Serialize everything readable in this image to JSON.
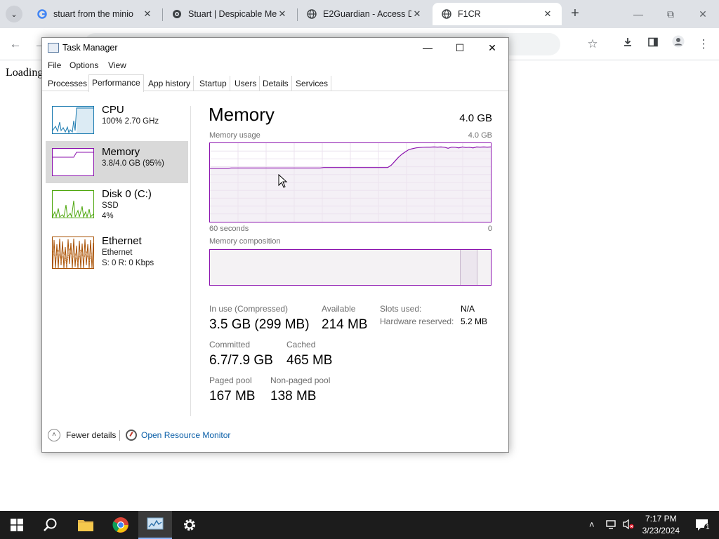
{
  "browser": {
    "tabs": [
      {
        "title": "stuart from the minio",
        "favicon": "google-g-icon",
        "active": false
      },
      {
        "title": "Stuart | Despicable Me",
        "favicon": "site-icon",
        "active": false
      },
      {
        "title": "E2Guardian - Access D",
        "favicon": "globe-icon",
        "active": false
      },
      {
        "title": "F1CR",
        "favicon": "globe-icon",
        "active": true
      }
    ],
    "new_tab": "+",
    "page_text": "Loading"
  },
  "task_manager": {
    "title": "Task Manager",
    "menu": [
      "File",
      "Options",
      "View"
    ],
    "tabs": [
      "Processes",
      "Performance",
      "App history",
      "Startup",
      "Users",
      "Details",
      "Services"
    ],
    "active_tab": "Performance",
    "sidebar": [
      {
        "name": "CPU",
        "line1": "100%  2.70 GHz",
        "line2": "",
        "color": "#1a7ab0"
      },
      {
        "name": "Memory",
        "line1": "3.8/4.0 GB (95%)",
        "line2": "",
        "color": "#8b12ae"
      },
      {
        "name": "Disk 0 (C:)",
        "line1": "SSD",
        "line2": "4%",
        "color": "#4da60c"
      },
      {
        "name": "Ethernet",
        "line1": "Ethernet",
        "line2": "S: 0  R: 0 Kbps",
        "color": "#a74f01"
      }
    ],
    "detail": {
      "title": "Memory",
      "total": "4.0 GB",
      "usage_label": "Memory usage",
      "usage_max": "4.0 GB",
      "time_left": "60 seconds",
      "time_right": "0",
      "composition_label": "Memory composition",
      "stats": {
        "in_use_label": "In use (Compressed)",
        "in_use": "3.5 GB (299 MB)",
        "available_label": "Available",
        "available": "214 MB",
        "committed_label": "Committed",
        "committed": "6.7/7.9 GB",
        "cached_label": "Cached",
        "cached": "465 MB",
        "paged_label": "Paged pool",
        "paged": "167 MB",
        "nonpaged_label": "Non-paged pool",
        "nonpaged": "138 MB"
      },
      "kv": {
        "slots_label": "Slots used:",
        "slots": "N/A",
        "hw_label": "Hardware reserved:",
        "hw": "5.2 MB"
      },
      "usage_series": [
        0.68,
        0.68,
        0.68,
        0.68,
        0.68,
        0.68,
        0.685,
        0.685,
        0.685,
        0.685,
        0.685,
        0.685,
        0.685,
        0.685,
        0.685,
        0.685,
        0.685,
        0.685,
        0.685,
        0.685,
        0.685,
        0.685,
        0.685,
        0.685,
        0.685,
        0.685,
        0.685,
        0.685,
        0.685,
        0.685,
        0.685,
        0.685,
        0.69,
        0.69,
        0.69,
        0.69,
        0.69,
        0.69,
        0.69,
        0.69,
        0.69,
        0.69,
        0.69,
        0.69,
        0.69,
        0.69,
        0.69,
        0.69,
        0.69,
        0.69,
        0.69,
        0.72,
        0.77,
        0.82,
        0.86,
        0.89,
        0.92,
        0.93,
        0.94,
        0.945,
        0.948,
        0.95,
        0.95,
        0.952,
        0.95,
        0.952,
        0.948,
        0.935,
        0.95,
        0.948,
        0.94,
        0.952,
        0.945,
        0.948,
        0.94,
        0.952,
        0.95,
        0.952,
        0.95,
        0.952
      ]
    },
    "footer": {
      "fewer": "Fewer details",
      "resmon": "Open Resource Monitor"
    }
  },
  "taskbar": {
    "time": "7:17 PM",
    "date": "3/23/2024",
    "notif_count": "1"
  }
}
